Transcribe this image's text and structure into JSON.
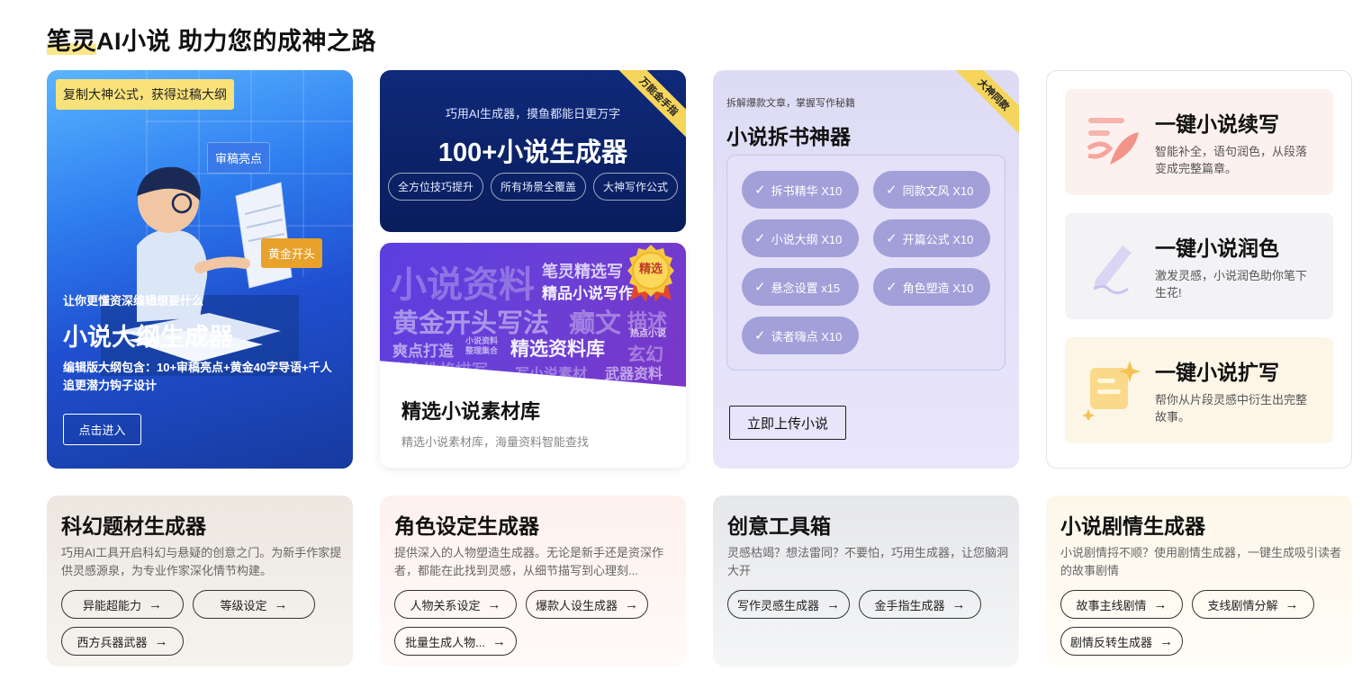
{
  "page": {
    "title_highlight": "笔灵",
    "title_rest": "AI小说 助力您的成神之路"
  },
  "outline_card": {
    "tag": "复制大神公式，获得过稿大纲",
    "bubble_review": "审稿亮点",
    "bubble_golden": "黄金开头",
    "subtitle": "让你更懂资深编辑想要什么",
    "title": "小说大纲生成器",
    "description": "编辑版大纲包含：10+审稿亮点+黄金40字导语+千人追更潜力钩子设计",
    "button": "点击进入"
  },
  "generators_card": {
    "kicker": "巧用AI生成器，摸鱼都能日更万字",
    "title": "100+小说生成器",
    "ribbon": "万能金手指",
    "pills": [
      "全方位技巧提升",
      "所有场景全覆盖",
      "大神写作公式"
    ]
  },
  "material_card": {
    "medal": "精选",
    "banner_words": {
      "w1": "小说资料",
      "w2": "笔灵精选写",
      "w3": "精品小说写作",
      "w4": "黄金开头写法",
      "w5": "癫文",
      "w6": "描述",
      "w7": "爽点打造",
      "w8": "小说资料",
      "w9": "整理集合",
      "w10": "精选资料库",
      "w11": "热点小说",
      "w12": "玄幻",
      "w13": "人物性格描写",
      "w14": "写小说素材",
      "w15": "武器资料"
    },
    "title": "精选小说素材库",
    "description": "精选小说素材库，海量资料智能查找"
  },
  "dismantle_card": {
    "kicker": "拆解爆款文章，掌握写作秘籍",
    "title": "小说拆书神器",
    "ribbon": "大神同款",
    "chips": [
      "拆书精华 X10",
      "同款文风 X10",
      "小说大纲 X10",
      "开篇公式 X10",
      "悬念设置 x15",
      "角色塑造 X10",
      "读者嗨点 X10"
    ],
    "upload_button": "立即上传小说"
  },
  "tools_card": {
    "items": [
      {
        "name": "一键小说续写",
        "desc": "智能补全，语句润色，从段落变成完整篇章。",
        "bg": "#fdf1ef"
      },
      {
        "name": "一键小说润色",
        "desc": "激发灵感，小说润色助你笔下生花!",
        "bg": "#f3f3f6"
      },
      {
        "name": "一键小说扩写",
        "desc": "帮你从片段灵感中衍生出完整故事。",
        "bg": "#fdf6e7"
      }
    ]
  },
  "bottom_cards": [
    {
      "title": "科幻题材生成器",
      "desc": "巧用AI工具开启科幻与悬疑的创意之门。为新手作家提供灵感源泉，为专业作家深化情节构建。",
      "buttons": [
        "异能超能力",
        "等级设定",
        "西方兵器武器"
      ]
    },
    {
      "title": "角色设定生成器",
      "desc": "提供深入的人物塑造生成器。无论是新手还是资深作者，都能在此找到灵感，从细节描写到心理刻...",
      "buttons": [
        "人物关系设定",
        "爆款人设生成器",
        "批量生成人物..."
      ]
    },
    {
      "title": "创意工具箱",
      "desc": "灵感枯竭？想法雷同？不要怕，巧用生成器，让您脑洞大开",
      "buttons": [
        "写作灵感生成器",
        "金手指生成器"
      ]
    },
    {
      "title": "小说剧情生成器",
      "desc": "小说剧情捋不顺？使用剧情生成器，一键生成吸引读者的故事剧情",
      "buttons": [
        "故事主线剧情",
        "支线剧情分解",
        "剧情反转生成器"
      ]
    }
  ],
  "icons": {
    "arrow": "arrow-right-icon",
    "check": "check-icon",
    "continue": "quill-icon",
    "polish": "pen-icon",
    "expand": "sparkle-note-icon"
  },
  "colors": {
    "accent_yellow": "#f9e27a",
    "navy": "#0f2a7a",
    "purple": "#6a3fd6",
    "lavender_chip": "#a39fd9"
  }
}
